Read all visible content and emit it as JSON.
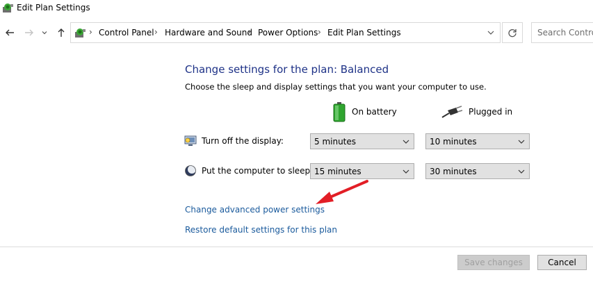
{
  "window": {
    "title": "Edit Plan Settings"
  },
  "nav": {
    "breadcrumb": [
      "Control Panel",
      "Hardware and Sound",
      "Power Options",
      "Edit Plan Settings"
    ],
    "search_placeholder": "Search Control"
  },
  "main": {
    "heading": "Change settings for the plan: Balanced",
    "description": "Choose the sleep and display settings that you want your computer to use.",
    "columns": {
      "battery": "On battery",
      "plugged": "Plugged in"
    },
    "rows": [
      {
        "label": "Turn off the display:",
        "battery": "5 minutes",
        "plugged": "10 minutes"
      },
      {
        "label": "Put the computer to sleep:",
        "battery": "15 minutes",
        "plugged": "30 minutes"
      }
    ],
    "links": {
      "advanced": "Change advanced power settings",
      "restore": "Restore default settings for this plan"
    }
  },
  "footer": {
    "save": "Save changes",
    "cancel": "Cancel"
  },
  "colors": {
    "heading": "#1e3287",
    "link": "#1a5a9c",
    "annotation_arrow": "#e21e26"
  }
}
